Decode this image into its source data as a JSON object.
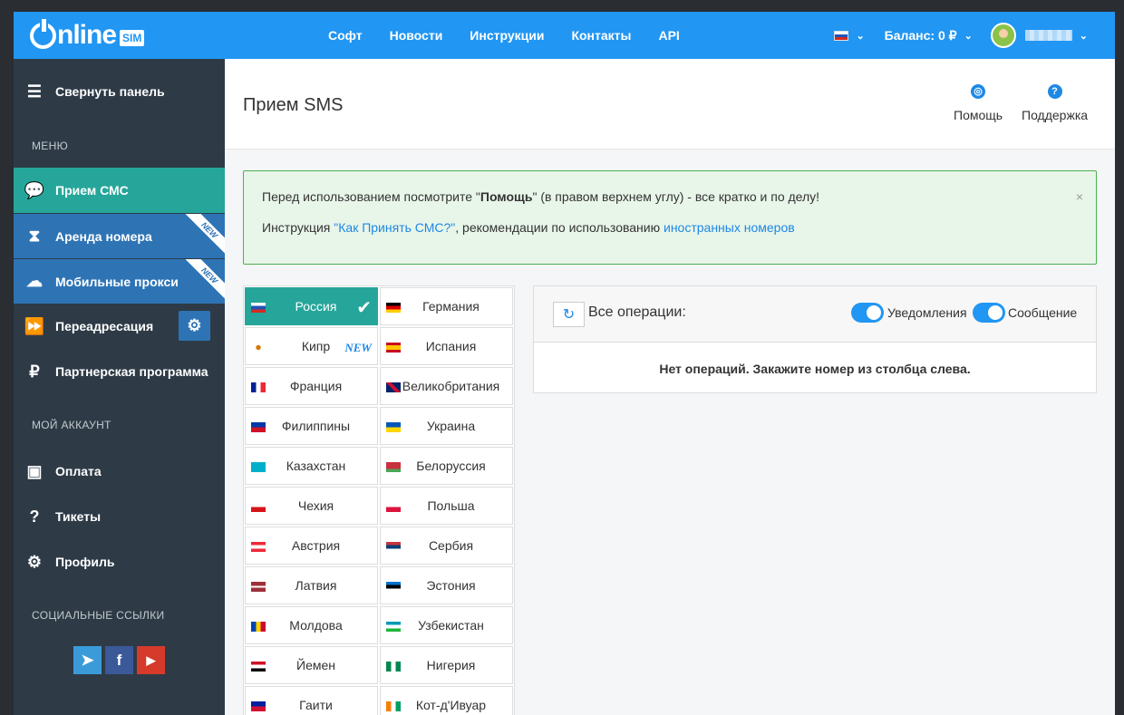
{
  "header": {
    "logo_text": "nline",
    "logo_badge": "SIM",
    "nav": [
      "Софт",
      "Новости",
      "Инструкции",
      "Контакты",
      "API"
    ],
    "balance": "Баланс: 0 ₽",
    "accent": "#2196f3"
  },
  "sidebar": {
    "collapse": "Свернуть панель",
    "menu_heading": "МЕНЮ",
    "items": [
      {
        "label": "Прием СМС",
        "icon": "chat-icon"
      },
      {
        "label": "Аренда номера",
        "icon": "hourglass-icon",
        "badge": "NEW"
      },
      {
        "label": "Мобильные прокси",
        "icon": "cloud-icon",
        "badge": "NEW"
      },
      {
        "label": "Переадресация",
        "icon": "forward-icon"
      },
      {
        "label": "Партнерская программа",
        "icon": "ruble-icon"
      }
    ],
    "account_heading": "МОЙ АККАУНТ",
    "account_items": [
      {
        "label": "Оплата",
        "icon": "wallet-icon"
      },
      {
        "label": "Тикеты",
        "icon": "question-icon"
      },
      {
        "label": "Профиль",
        "icon": "gear-icon"
      }
    ],
    "social_heading": "СОЦИАЛЬНЫЕ ССЫЛКИ"
  },
  "page": {
    "title": "Прием SMS",
    "help": "Помощь",
    "support": "Поддержка"
  },
  "alert": {
    "line1_a": "Перед использованием посмотрите \"",
    "line1_b": "Помощь",
    "line1_c": "\" (в правом верхнем углу) - все кратко и по делу!",
    "line2_a": "Инструкция ",
    "line2_link1": "\"Как Принять СМС?\"",
    "line2_b": ", рекомендации по использованию ",
    "line2_link2": "иностранных номеров",
    "close": "×"
  },
  "countries": [
    [
      "Россия",
      "Германия"
    ],
    [
      "Кипр",
      "Испания"
    ],
    [
      "Франция",
      "Великобритания"
    ],
    [
      "Филиппины",
      "Украина"
    ],
    [
      "Казахстан",
      "Белоруссия"
    ],
    [
      "Чехия",
      "Польша"
    ],
    [
      "Австрия",
      "Сербия"
    ],
    [
      "Латвия",
      "Эстония"
    ],
    [
      "Молдова",
      "Узбекистан"
    ],
    [
      "Йемен",
      "Нигерия"
    ],
    [
      "Гаити",
      "Кот-д'Ивуар"
    ]
  ],
  "country_new_badge": "NEW",
  "operations": {
    "title": "Все операции:",
    "toggle1": "Уведомления",
    "toggle2": "Сообщение",
    "empty": "Нет операций. Закажите номер из столбца слева."
  }
}
